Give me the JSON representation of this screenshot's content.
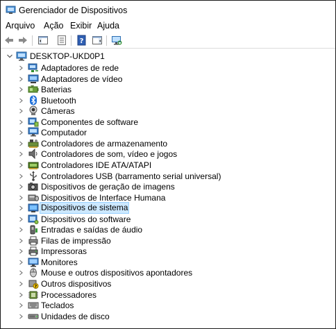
{
  "window": {
    "title": "Gerenciador de Dispositivos"
  },
  "menubar": {
    "items": [
      "Arquivo",
      "Ação",
      "Exibir",
      "Ajuda"
    ]
  },
  "toolbar": {
    "buttons": [
      "back-arrow-icon",
      "forward-arrow-icon",
      "show-hide-console-tree-icon",
      "properties-icon",
      "help-icon",
      "action-pane-icon",
      "scan-hardware-icon"
    ]
  },
  "tree": {
    "root": {
      "label": "DESKTOP-UKD0P1",
      "expanded": true
    },
    "selected_index": 13,
    "items": [
      {
        "label": "Adaptadores de rede",
        "icon": "network-adapter-icon"
      },
      {
        "label": "Adaptadores de vídeo",
        "icon": "display-adapter-icon"
      },
      {
        "label": "Baterias",
        "icon": "battery-icon"
      },
      {
        "label": "Bluetooth",
        "icon": "bluetooth-icon"
      },
      {
        "label": "Câmeras",
        "icon": "camera-icon"
      },
      {
        "label": "Componentes de software",
        "icon": "software-component-icon"
      },
      {
        "label": "Computador",
        "icon": "computer-icon"
      },
      {
        "label": "Controladores de armazenamento",
        "icon": "storage-controller-icon"
      },
      {
        "label": "Controladores de som, vídeo e jogos",
        "icon": "speaker-icon"
      },
      {
        "label": "Controladores IDE ATA/ATAPI",
        "icon": "ide-controller-icon"
      },
      {
        "label": "Controladores USB (barramento serial universal)",
        "icon": "usb-icon"
      },
      {
        "label": "Dispositivos de geração de imagens",
        "icon": "imaging-device-icon"
      },
      {
        "label": "Dispositivos de Interface Humana",
        "icon": "hid-icon"
      },
      {
        "label": "Dispositivos de sistema",
        "icon": "system-device-icon"
      },
      {
        "label": "Dispositivos do software",
        "icon": "software-device-icon"
      },
      {
        "label": "Entradas e saídas de áudio",
        "icon": "audio-io-icon"
      },
      {
        "label": "Filas de impressão",
        "icon": "print-queue-icon"
      },
      {
        "label": "Impressoras",
        "icon": "printer-icon"
      },
      {
        "label": "Monitores",
        "icon": "monitor-icon"
      },
      {
        "label": "Mouse e outros dispositivos apontadores",
        "icon": "mouse-icon"
      },
      {
        "label": "Outros dispositivos",
        "icon": "other-device-icon"
      },
      {
        "label": "Processadores",
        "icon": "processor-icon"
      },
      {
        "label": "Teclados",
        "icon": "keyboard-icon"
      },
      {
        "label": "Unidades de disco",
        "icon": "disk-drive-icon"
      }
    ]
  },
  "colors": {
    "selection_bg": "#cce8ff",
    "selection_border": "#99d1ff",
    "chevron": "#707070"
  }
}
